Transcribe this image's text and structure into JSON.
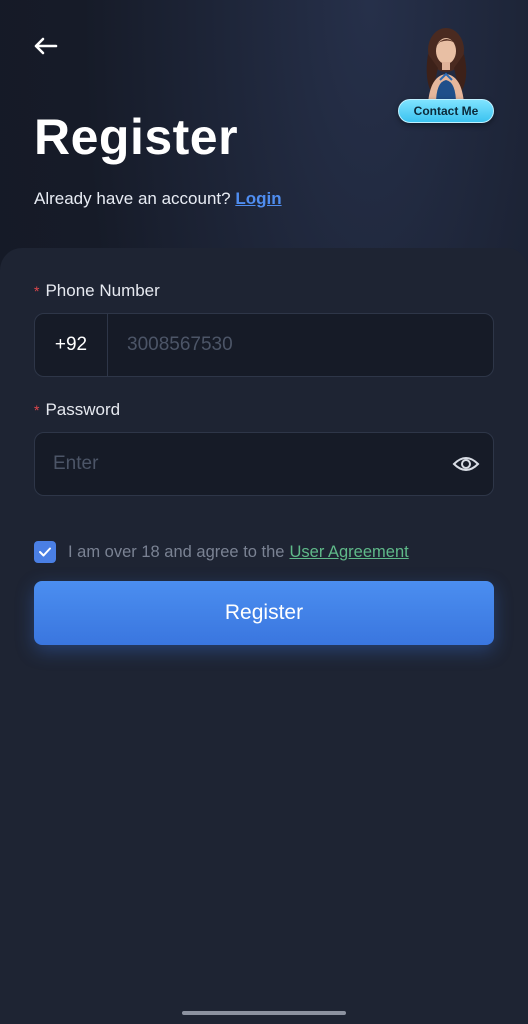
{
  "header": {
    "back_icon": "arrow-left-icon",
    "contact_label": "Contact Me",
    "title": "Register",
    "account_prompt": "Already have an account?",
    "login_link": "Login"
  },
  "form": {
    "phone_label": "Phone Number",
    "required_mark": "*",
    "country_code": "+92",
    "phone_placeholder": "3008567530",
    "password_label": "Password",
    "password_placeholder": "Enter",
    "password_toggle_icon": "eye-icon",
    "agree_checked": true,
    "agree_text": "I am over 18 and agree to the",
    "agree_link": "User Agreement",
    "submit_label": "Register"
  },
  "colors": {
    "accent": "#4a7fe4",
    "link": "#4f8df0",
    "agreement_link": "#5fb989",
    "required": "#e0474c",
    "background": "#1c2230"
  }
}
